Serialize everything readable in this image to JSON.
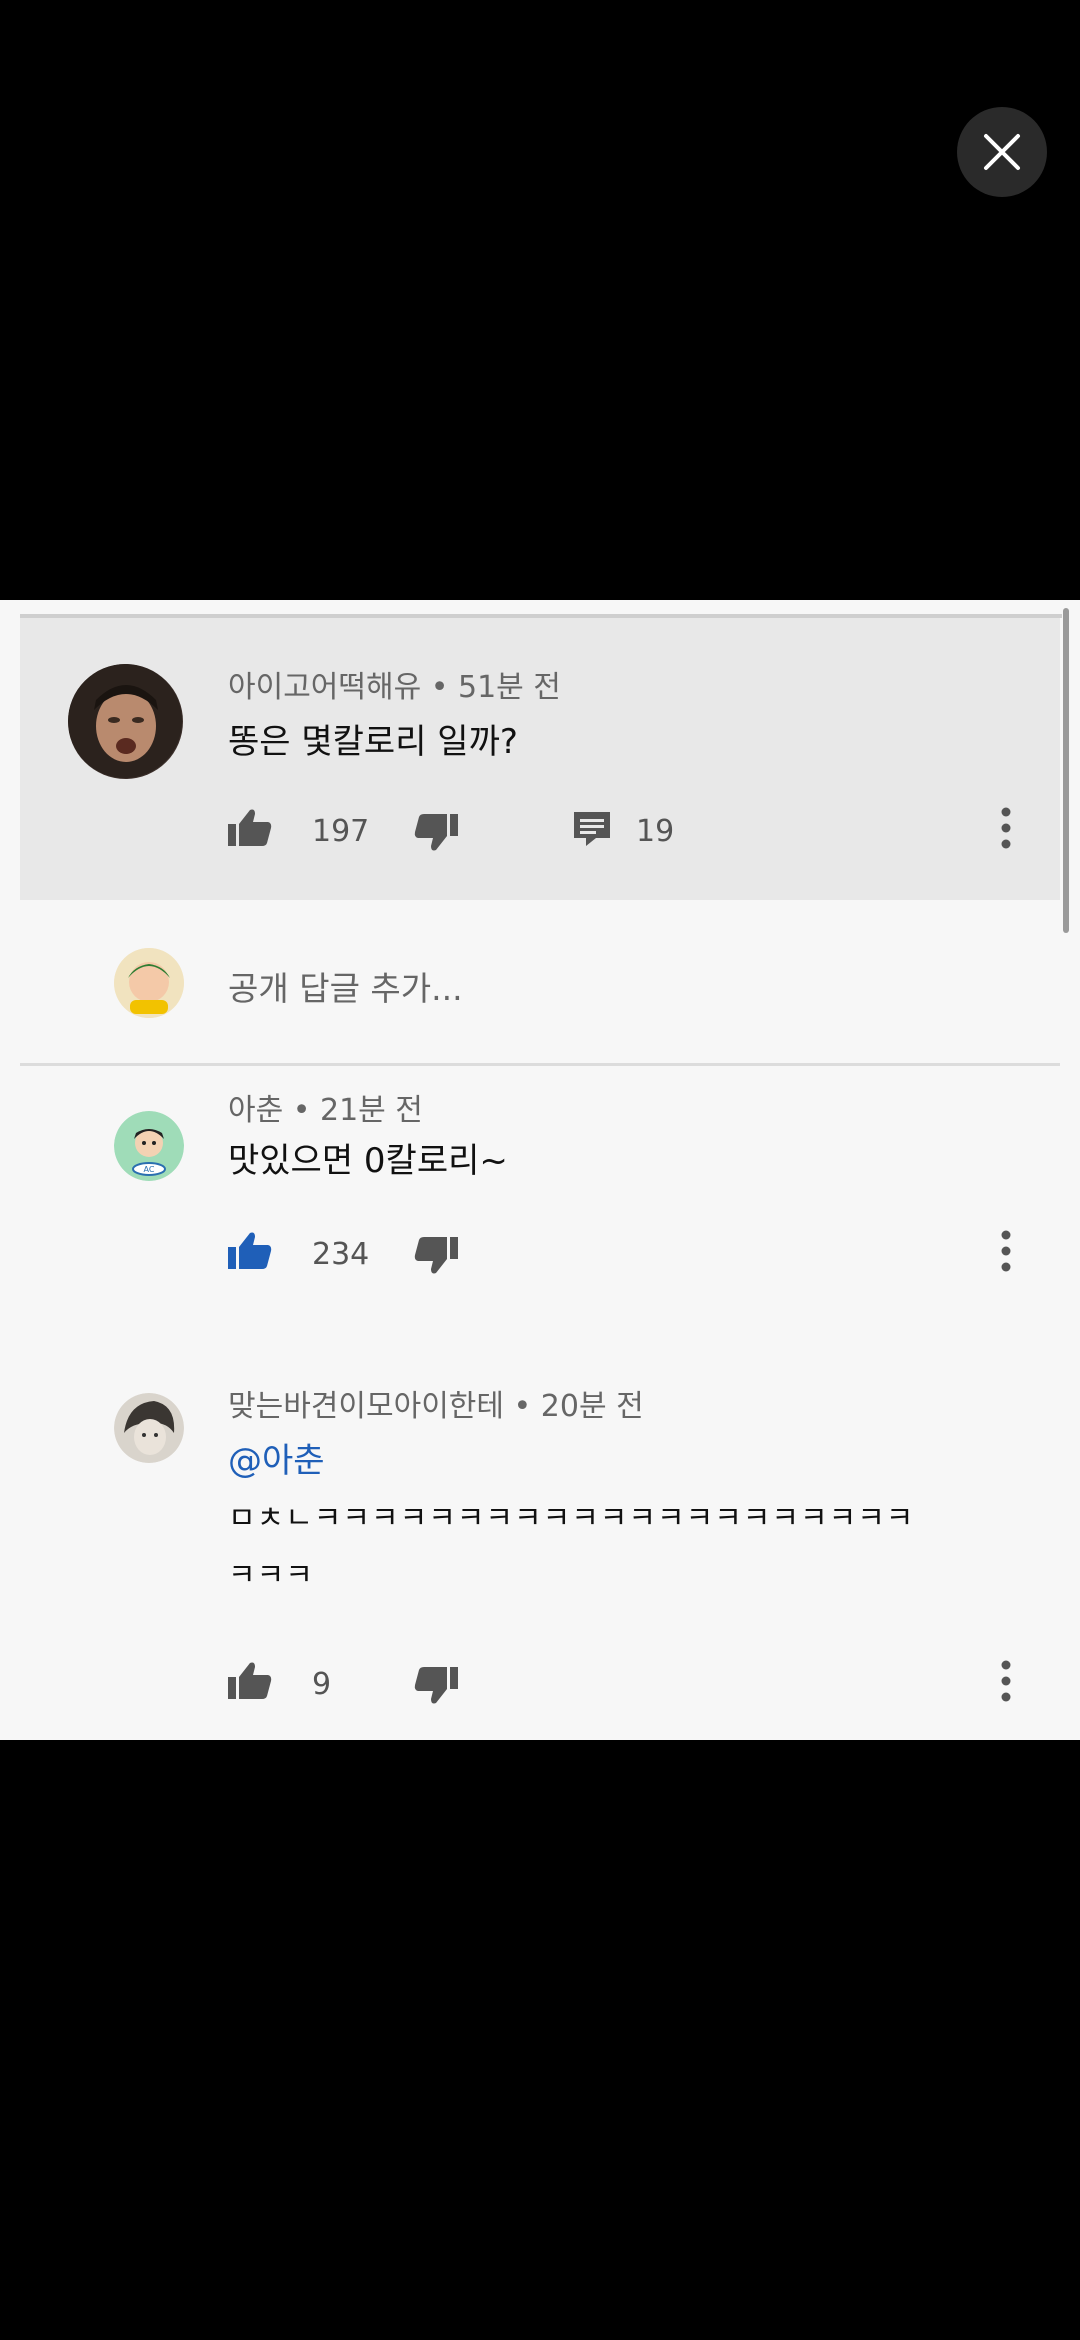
{
  "comments": [
    {
      "author": "아이고어떡해유",
      "time": "51분 전",
      "text": "똥은 몇칼로리 일까?",
      "likes": "197",
      "replies": "19"
    },
    {
      "author": "아춘",
      "time": "21분 전",
      "text": "맛있으면 0칼로리~",
      "likes": "234"
    },
    {
      "author": "맞는바견이모아이한테",
      "time": "20분 전",
      "mention": "@아춘",
      "line1": "ㅁㅊㄴㅋㅋㅋㅋㅋㅋㅋㅋㅋㅋㅋㅋㅋㅋㅋㅋㅋㅋㅋㅋㅋ",
      "line2": "ㅋㅋㅋ",
      "likes": "9"
    }
  ],
  "reply_placeholder": "공개 답글 추가...",
  "separator": "•",
  "icons": [
    "close-icon",
    "thumbs-up-icon",
    "thumbs-down-icon",
    "reply-icon",
    "more-vert-icon"
  ],
  "colors": {
    "accent_blue": "#1f5fb8",
    "highlight_bg": "#e8e8e8"
  }
}
